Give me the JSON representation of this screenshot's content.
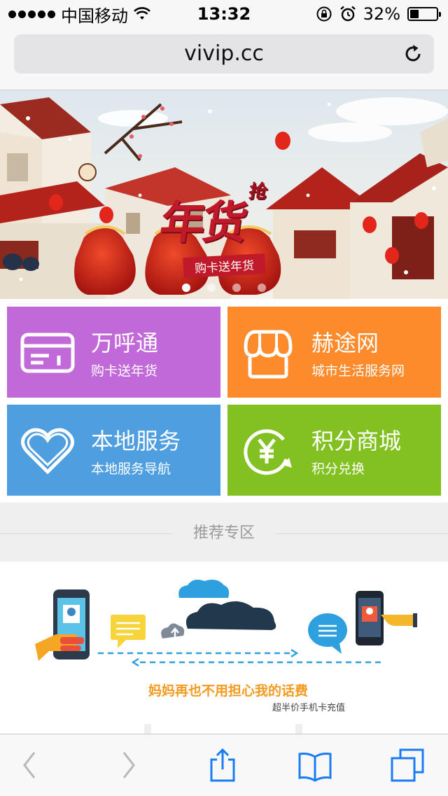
{
  "status_bar": {
    "carrier": "中国移动",
    "time": "13:32",
    "battery_text": "32%",
    "battery_level": 0.32,
    "icons": [
      "signal-dots-icon",
      "wifi-icon",
      "rotation-lock-icon",
      "alarm-icon",
      "battery-icon"
    ]
  },
  "browser": {
    "url": "vivip.cc",
    "icons": [
      "reload-icon",
      "back-icon",
      "forward-icon",
      "share-icon",
      "bookmarks-icon",
      "tabs-icon"
    ]
  },
  "banner": {
    "title": "年货",
    "title_accent": "抢",
    "subtitle": "购卡送年货",
    "slide_count": 4,
    "active_slide": 1
  },
  "tiles": [
    {
      "title": "万呼通",
      "subtitle": "购卡送年货",
      "color": "#c169d8",
      "icon": "card-icon"
    },
    {
      "title": "赫途网",
      "subtitle": "城市生活服务网",
      "color": "#fd8a2b",
      "icon": "shop-icon"
    },
    {
      "title": "本地服务",
      "subtitle": "本地服务导航",
      "color": "#4f9ee0",
      "icon": "heart-icon"
    },
    {
      "title": "积分商城",
      "subtitle": "积分兑换",
      "color": "#82c121",
      "icon": "yen-exchange-icon"
    }
  ],
  "section": {
    "title": "推荐专区"
  },
  "promo": {
    "caption": "妈妈再也不用担心我的话费",
    "subcaption": "超半价手机卡充值"
  }
}
